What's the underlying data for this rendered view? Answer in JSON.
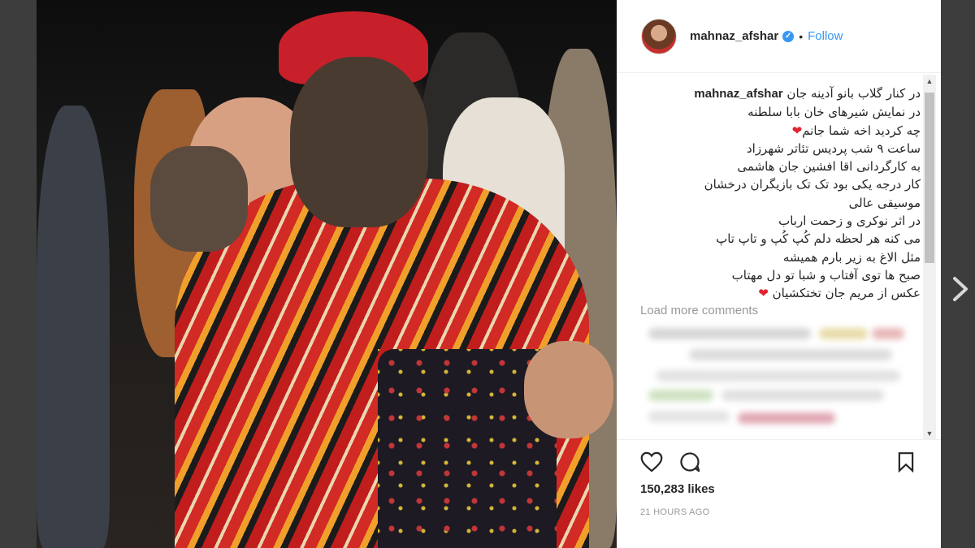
{
  "post": {
    "username": "mahnaz_afshar",
    "verified_symbol": "✓",
    "separator": "•",
    "follow_label": "Follow"
  },
  "caption": {
    "username": "mahnaz_afshar",
    "lines": [
      "در کنار گلاب بانو آدینه جان",
      "در نمایش شیرهای خان بابا سلطنه",
      "چه کردید اخه شما جانم",
      "ساعت ۹ شب پردیس تئاتر شهرزاد",
      "به کارگردانی اقا افشین جان هاشمی",
      "کار درجه یکی بود تک تک بازیگران درخشان",
      "موسیقی عالی",
      "در اثر نوکری و زحمت ارباب",
      "می کنه هر لحظه دلم کُپ کُپ و تاپ تاپ",
      "مثل الاغ به زیر بارم همیشه",
      "صبح ها توی آفتاب و شبا تو دل مهتاب",
      "عکس از مریم جان تختکشیان"
    ],
    "heart": "❤"
  },
  "comments": {
    "load_more_label": "Load more comments"
  },
  "engagement": {
    "likes": "150,283 likes",
    "time": "21 HOURS AGO"
  },
  "colors": {
    "accent": "#3897f0",
    "heart": "#e0242e",
    "muted": "#999999"
  },
  "icons": [
    "heart-icon",
    "comment-icon",
    "bookmark-icon",
    "chevron-right-icon",
    "verified-icon"
  ]
}
